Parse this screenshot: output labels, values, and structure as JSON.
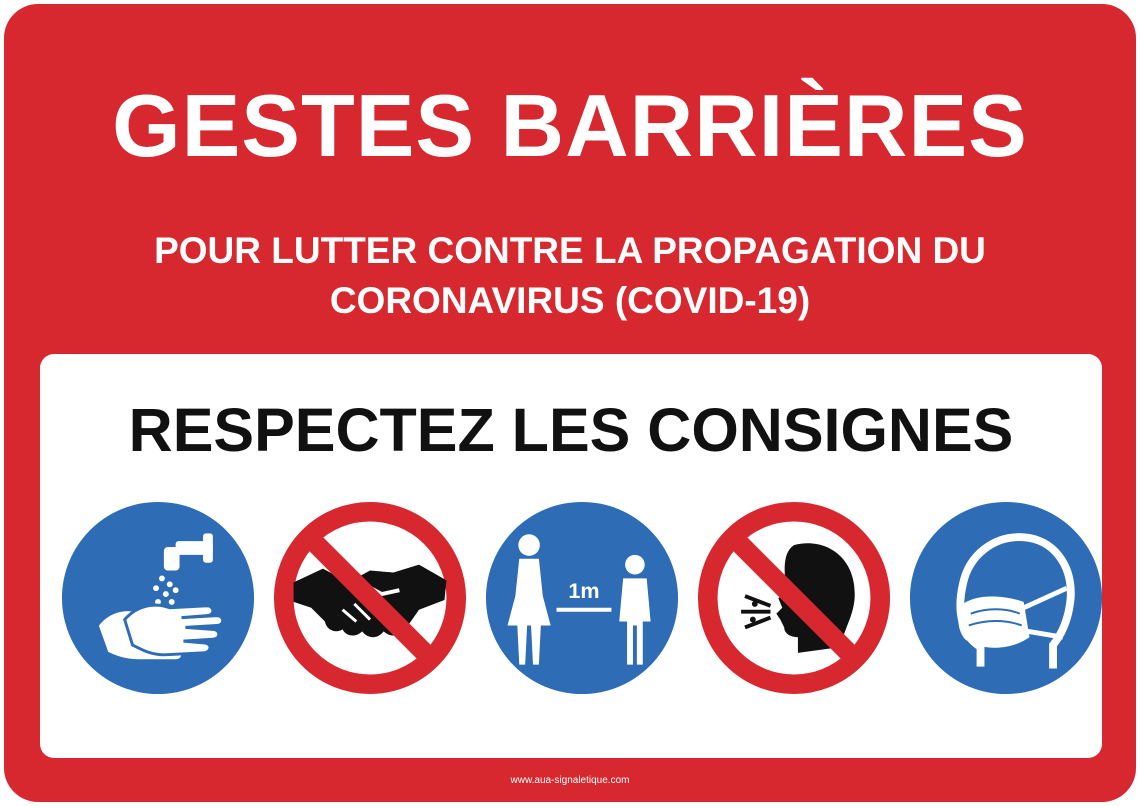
{
  "sign": {
    "title": "GESTES BARRIÈRES",
    "subtitle": "POUR LUTTER CONTRE LA PROPAGATION DU CORONAVIRUS (COVID-19)",
    "heading": "RESPECTEZ LES CONSIGNES",
    "distance_label": "1m",
    "footer": "www.aua-signaletique.com"
  },
  "icons": [
    "wash-hands-icon",
    "no-handshake-icon",
    "keep-distance-icon",
    "no-cough-icon",
    "face-mask-icon"
  ],
  "colors": {
    "sign_red": "#d7282f",
    "mandatory_blue": "#2e6db5",
    "prohibition_red": "#d7282f",
    "panel_white": "#ffffff",
    "text_black": "#111111"
  }
}
